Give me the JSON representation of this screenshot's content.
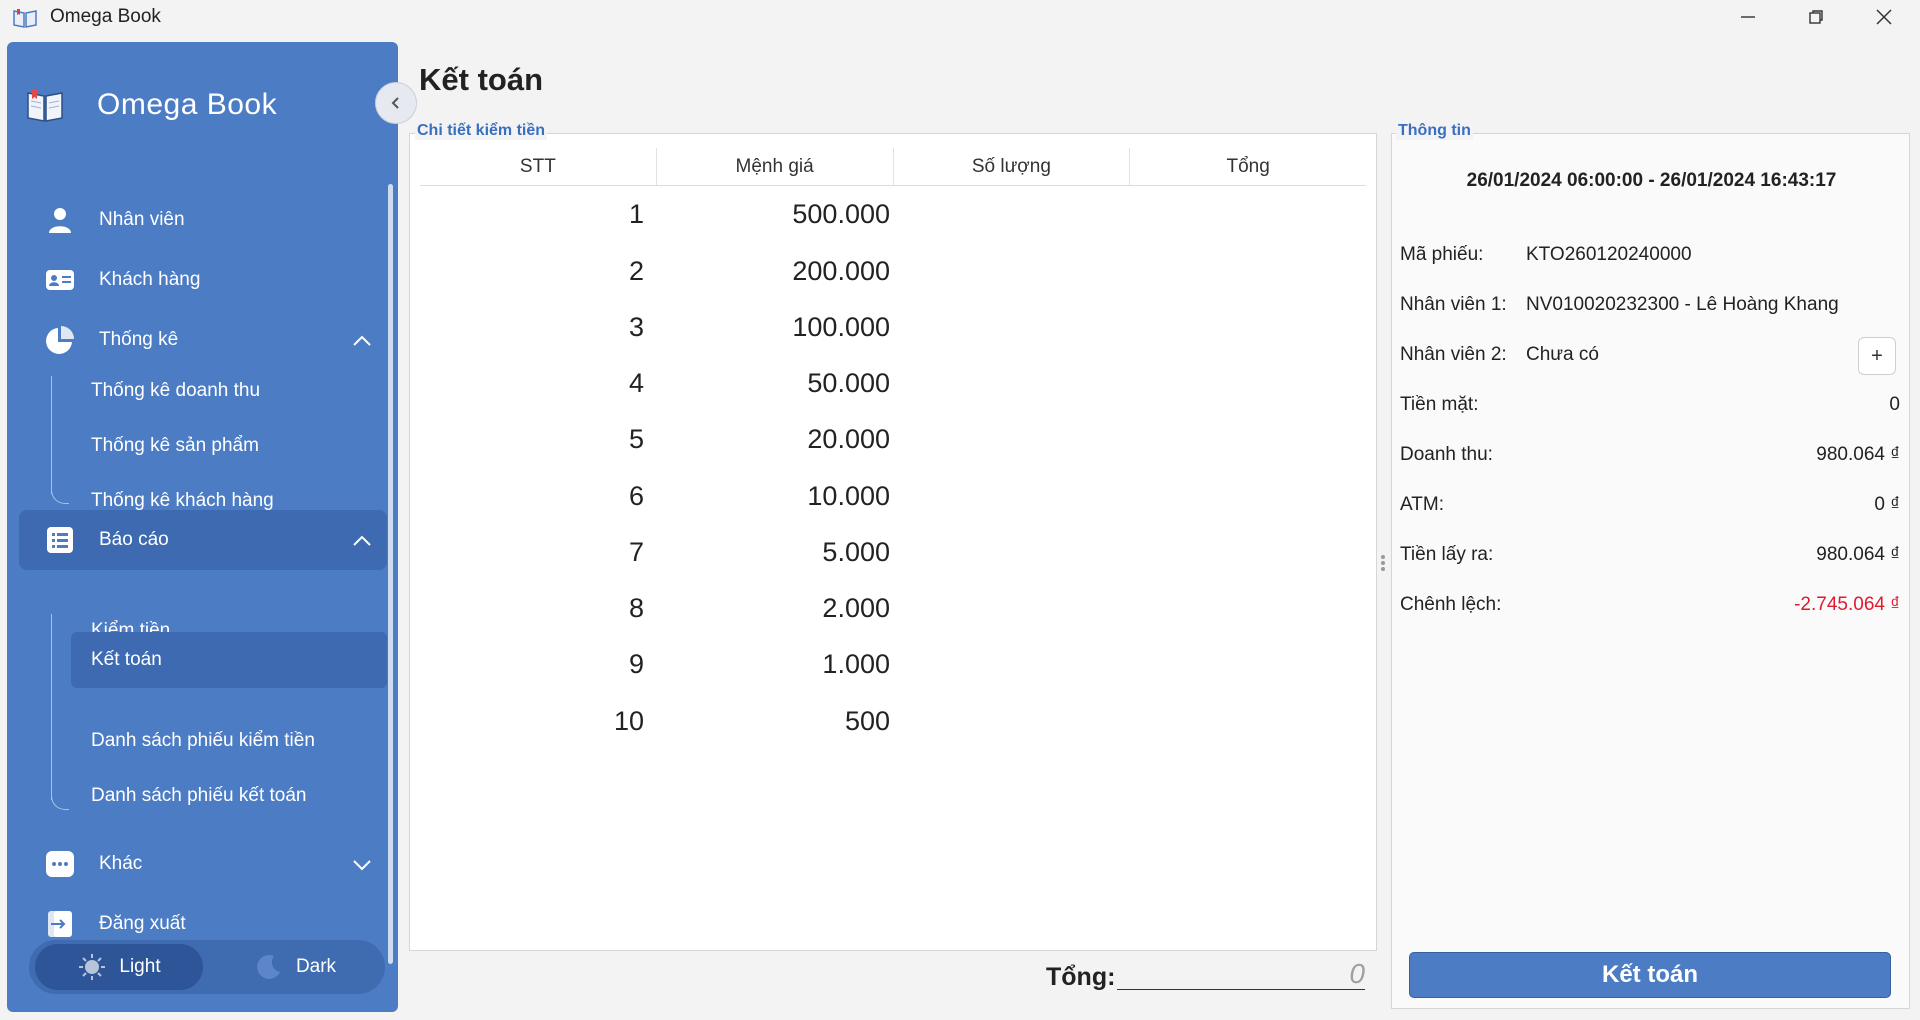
{
  "window": {
    "title": "Omega Book"
  },
  "sidebar": {
    "brand": "Omega Book",
    "items": {
      "nhan_vien": "Nhân viên",
      "khach_hang": "Khách hàng",
      "thong_ke": "Thống kê",
      "bao_cao": "Báo cáo",
      "khac": "Khác",
      "dang_xuat": "Đăng xuất"
    },
    "thong_ke_sub": [
      "Thống kê doanh thu",
      "Thống kê sản phẩm",
      "Thống kê khách hàng"
    ],
    "bao_cao_sub": [
      "Kiểm tiền",
      "Kết toán",
      "Danh sách phiếu kiểm tiền",
      "Danh sách phiếu kết toán"
    ],
    "theme": {
      "light": "Light",
      "dark": "Dark",
      "selected": "Light"
    }
  },
  "main": {
    "title": "Kết toán",
    "detail": {
      "legend": "Chi tiết kiểm tiền",
      "columns": [
        "STT",
        "Mệnh giá",
        "Số lượng",
        "Tổng"
      ],
      "rows": [
        {
          "stt": "1",
          "menh_gia": "500.000"
        },
        {
          "stt": "2",
          "menh_gia": "200.000"
        },
        {
          "stt": "3",
          "menh_gia": "100.000"
        },
        {
          "stt": "4",
          "menh_gia": "50.000"
        },
        {
          "stt": "5",
          "menh_gia": "20.000"
        },
        {
          "stt": "6",
          "menh_gia": "10.000"
        },
        {
          "stt": "7",
          "menh_gia": "5.000"
        },
        {
          "stt": "8",
          "menh_gia": "2.000"
        },
        {
          "stt": "9",
          "menh_gia": "1.000"
        },
        {
          "stt": "10",
          "menh_gia": "500"
        }
      ],
      "total_label": "Tổng:",
      "total_value": "0"
    },
    "info": {
      "legend": "Thông tin",
      "period": "26/01/2024 06:00:00 - 26/01/2024 16:43:17",
      "ma_phieu_label": "Mã phiếu:",
      "ma_phieu": "KTO260120240000",
      "nhan_vien_1_label": "Nhân viên 1:",
      "nhan_vien_1": "NV010020232300 - Lê Hoàng Khang",
      "nhan_vien_2_label": "Nhân viên 2:",
      "nhan_vien_2": "Chưa có",
      "add_label": "+",
      "tien_mat_label": "Tiền mặt:",
      "tien_mat": "0",
      "doanh_thu_label": "Doanh thu:",
      "doanh_thu": "980.064 ₫",
      "atm_label": "ATM:",
      "atm": "0 ₫",
      "tien_lay_ra_label": "Tiền lấy ra:",
      "tien_lay_ra": "980.064 ₫",
      "chenh_lech_label": "Chênh lệch:",
      "chenh_lech": "-2.745.064 ₫",
      "submit_label": "Kết toán"
    }
  },
  "colors": {
    "sidebar": "#4c7cc4",
    "accent": "#3a6fc0",
    "negative": "#e0192f"
  }
}
